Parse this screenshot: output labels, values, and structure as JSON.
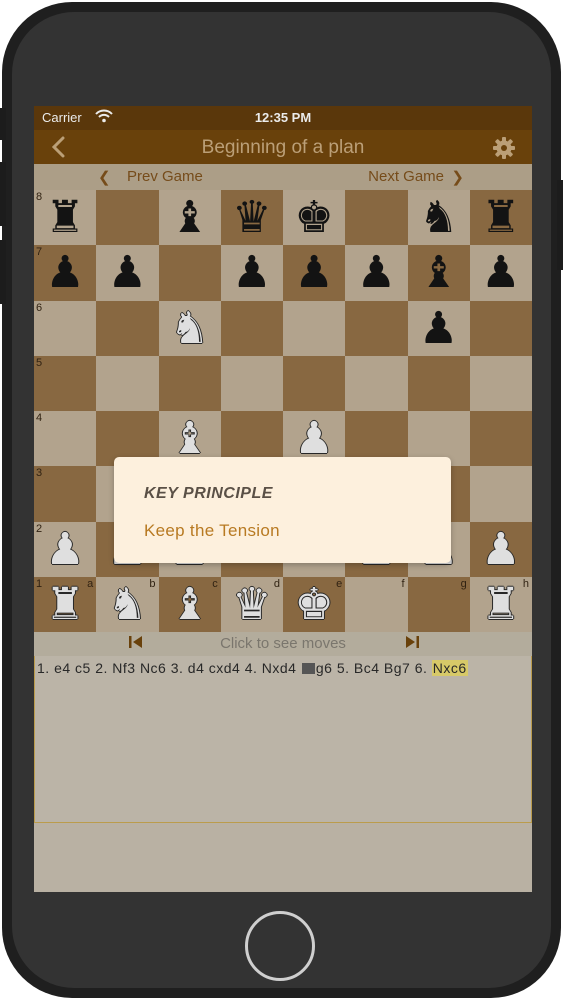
{
  "status_bar": {
    "carrier": "Carrier",
    "time": "12:35 PM"
  },
  "nav": {
    "title": "Beginning of a plan",
    "back_icon": "chevron-left-icon",
    "settings_icon": "gear-icon"
  },
  "game_nav": {
    "prev_label": "Prev Game",
    "next_label": "Next Game"
  },
  "board": {
    "ranks": [
      "8",
      "7",
      "6",
      "5",
      "4",
      "3",
      "2",
      "1"
    ],
    "files": [
      "a",
      "b",
      "c",
      "d",
      "e",
      "f",
      "g",
      "h"
    ],
    "light_color": "#bfae94",
    "dark_color": "#8f6a3e",
    "rows": [
      [
        "r",
        "",
        "b",
        "q",
        "k",
        "",
        "n",
        "r"
      ],
      [
        "p",
        "p",
        "",
        "p",
        "p",
        "p",
        "b",
        "p"
      ],
      [
        "",
        "",
        "N",
        "",
        "",
        "",
        "p",
        ""
      ],
      [
        "",
        "",
        "",
        "",
        "",
        "",
        "",
        ""
      ],
      [
        "",
        "",
        "B",
        "",
        "P",
        "",
        "",
        ""
      ],
      [
        "",
        "",
        "",
        "",
        "",
        "",
        "",
        ""
      ],
      [
        "P",
        "P",
        "P",
        "",
        "",
        "P",
        "P",
        "P"
      ],
      [
        "R",
        "N",
        "B",
        "Q",
        "K",
        "",
        "",
        "R"
      ]
    ]
  },
  "move_nav": {
    "label": "Click to see moves",
    "first_icon": "skip-first-icon",
    "last_icon": "skip-last-icon"
  },
  "moves": {
    "before_comment": "1. e4 c5 2. Nf3 Nc6 3. d4 cxd4 4. Nxd4 ",
    "comment_icon": "comment-icon",
    "after_comment": "g6 5. Bc4 Bg7 6. ",
    "current": "Nxc6"
  },
  "popup": {
    "heading": "KEY PRINCIPLE",
    "body": "Keep the Tension"
  }
}
